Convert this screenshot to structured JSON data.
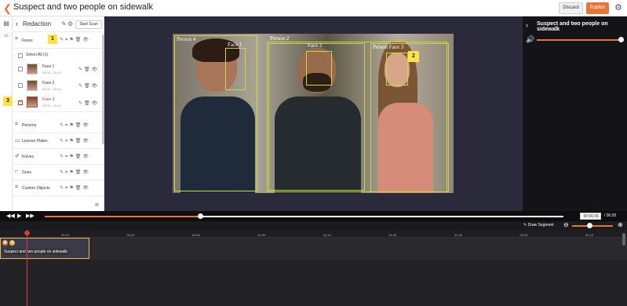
{
  "header": {
    "title": "Suspect and two people on sidewalk",
    "discard_label": "Discard",
    "publish_label": "Publish"
  },
  "panel": {
    "title": "Redaction",
    "start_scan_label": "Start Scan",
    "categories": {
      "faces": "Faces",
      "persons": "Persons",
      "license_plates": "License Plates",
      "knives": "Knives",
      "guns": "Guns",
      "custom_objects": "Custom Objects"
    },
    "select_all": "Select All (1)",
    "faces": [
      {
        "name": "Face 1",
        "time": "00:00 - 00:15"
      },
      {
        "name": "Face 2",
        "time": "00:00 - 00:15"
      },
      {
        "name": "Face 3",
        "time": "00:00 - 00:15"
      }
    ],
    "badges": {
      "one": "1",
      "three": "3"
    }
  },
  "video": {
    "labels": {
      "person4": "Person 4",
      "face_a": "Face 1",
      "person2": "Person 2",
      "face_b": "Face 2",
      "person3": "Person Face 3"
    },
    "badge_two": "2"
  },
  "right_panel": {
    "title": "Suspect and two people on sidewalk",
    "volume": 0.95
  },
  "player": {
    "current_time": "00:00.06",
    "total_time": "/ 00:20",
    "progress": 0.3
  },
  "timeline": {
    "draw_segment_label": "Draw Segment",
    "ticks": [
      "00:00",
      "00:10",
      "00:30",
      "00:40",
      "01:00",
      "01:10",
      "01:30",
      "01:40",
      "02:00",
      "02:10"
    ],
    "clip_label": "Suspect and two people on sidewalk"
  },
  "colors": {
    "accent": "#e8743b",
    "bbox": "#c8d64a",
    "badge": "#ffe14d"
  }
}
